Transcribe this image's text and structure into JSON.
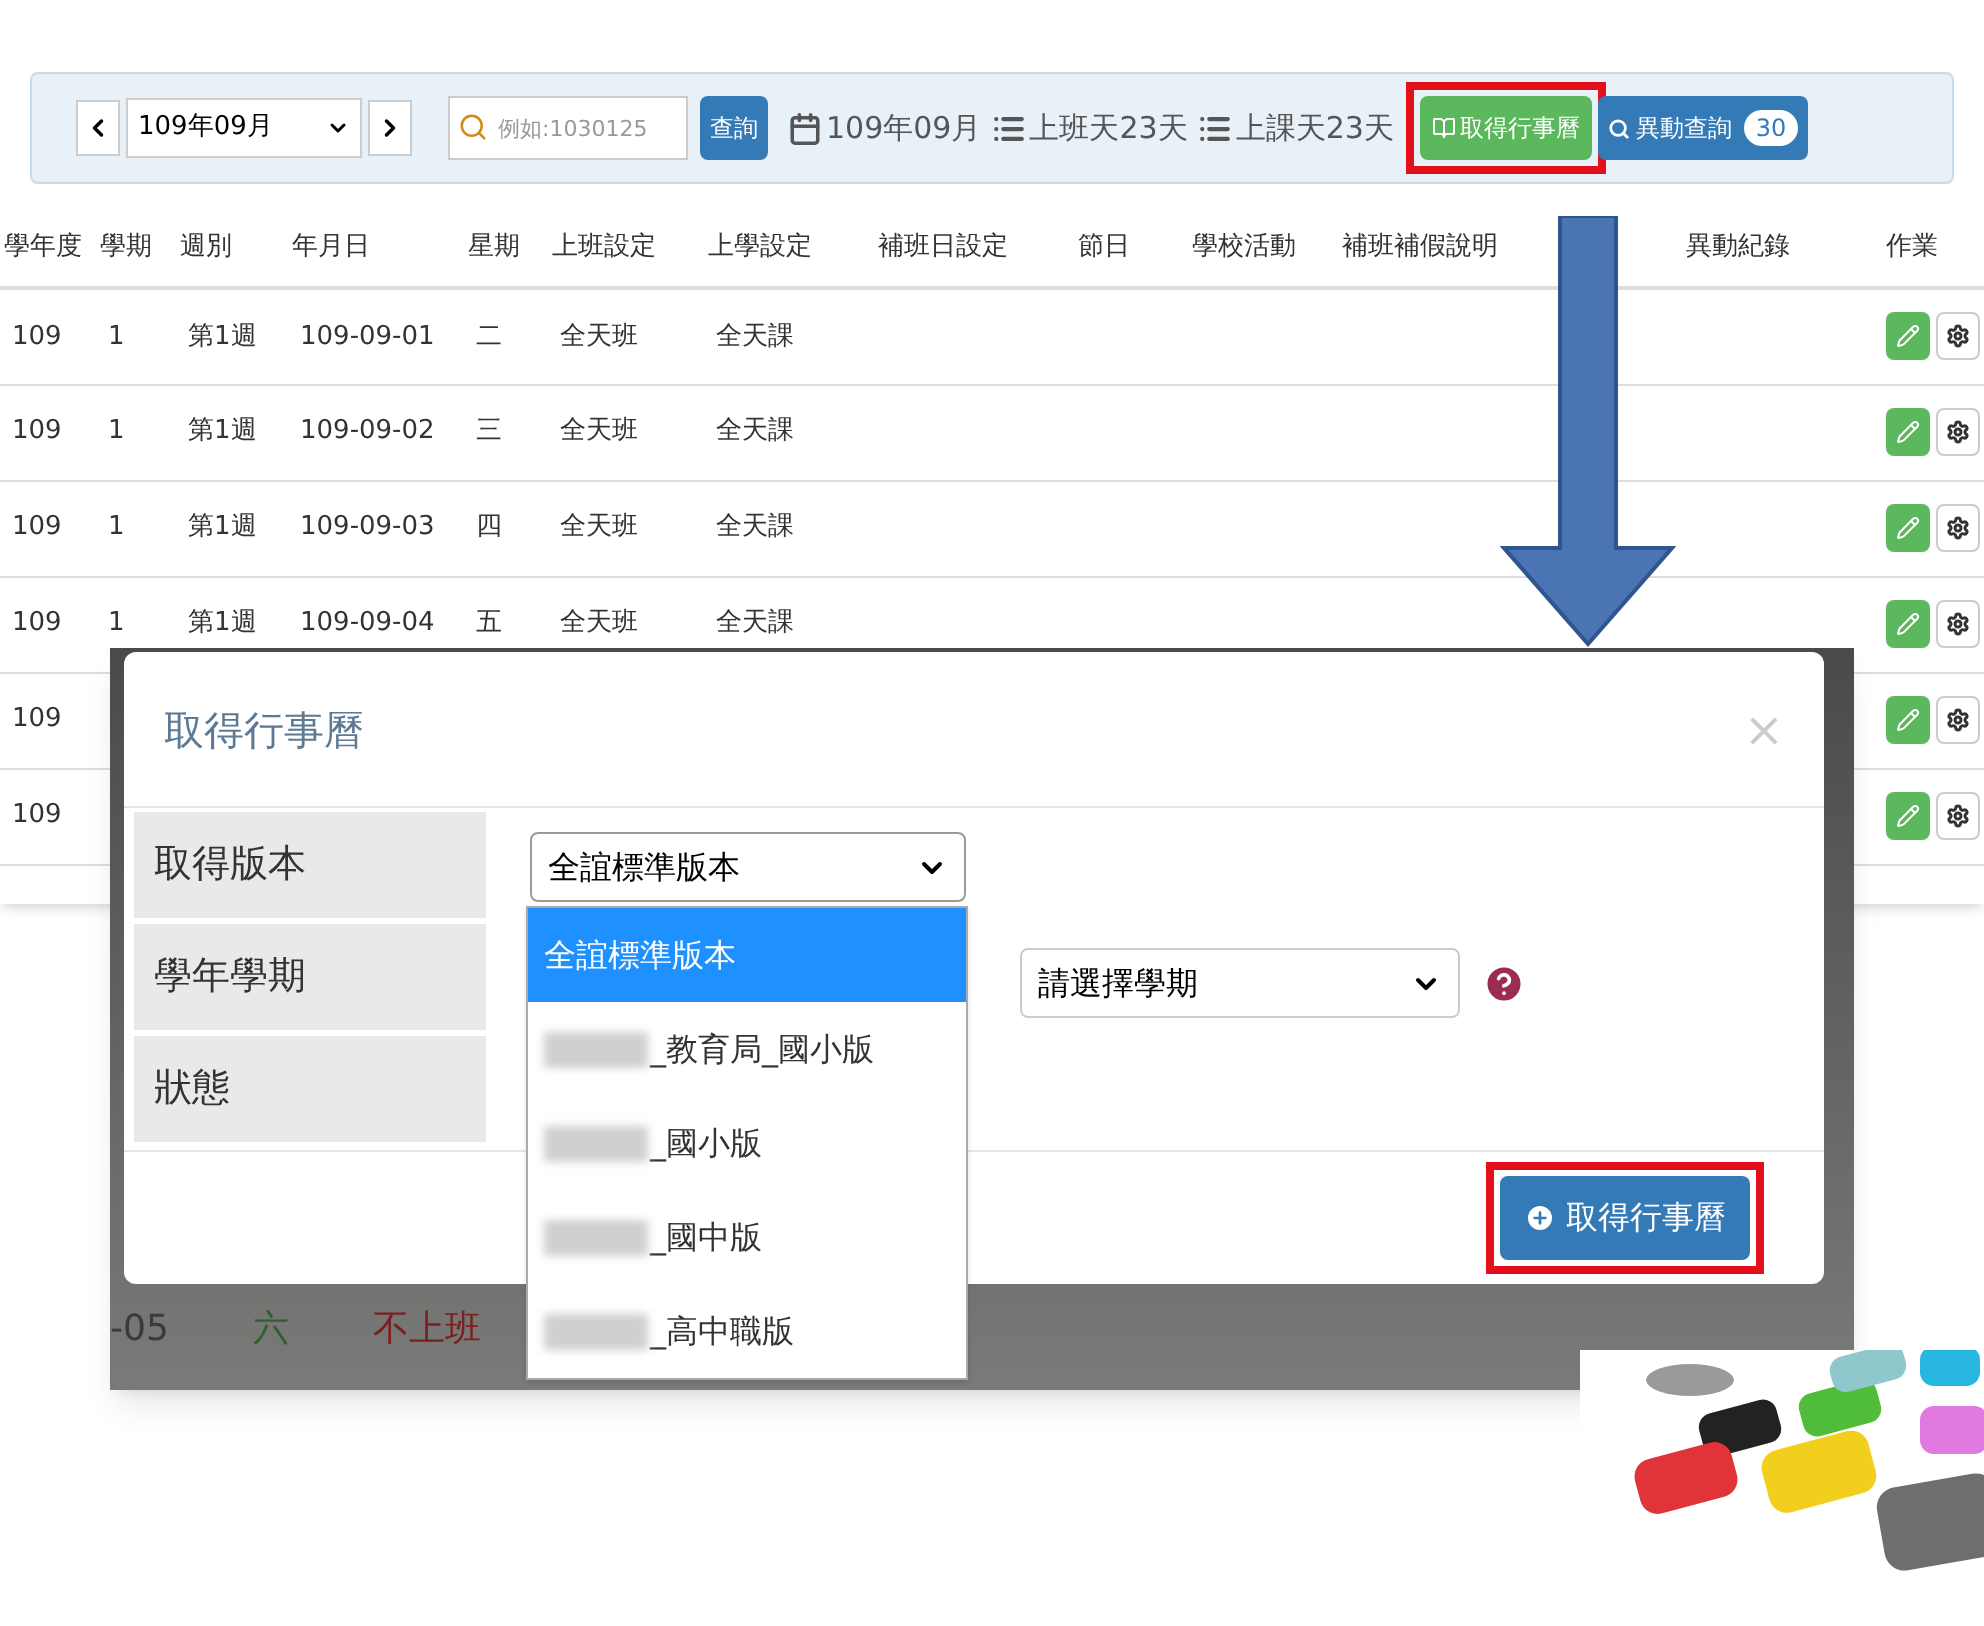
{
  "toolbar": {
    "month_select": {
      "value": "109年09月"
    },
    "search": {
      "placeholder": "例如:1030125"
    },
    "query_button": "查詢",
    "summary": [
      {
        "kind": "calendar",
        "text": "109年09月"
      },
      {
        "kind": "list",
        "text": "上班天23天"
      },
      {
        "kind": "list",
        "text": "上課天23天"
      }
    ],
    "fetch_button": {
      "label": "取得行事曆",
      "highlighted": true
    },
    "changes_button": {
      "label": "異動查詢",
      "badge": "30"
    }
  },
  "table": {
    "columns": [
      "學年度",
      "學期",
      "週別",
      "年月日",
      "星期",
      "上班設定",
      "上學設定",
      "補班日設定",
      "節日",
      "學校活動",
      "補班補假說明",
      "異動紀錄",
      "作業"
    ],
    "rows": [
      {
        "cells": [
          "109",
          "1",
          "第1週",
          "109-09-01",
          "二",
          "全天班",
          "全天課"
        ]
      },
      {
        "cells": [
          "109",
          "1",
          "第1週",
          "109-09-02",
          "三",
          "全天班",
          "全天課"
        ]
      },
      {
        "cells": [
          "109",
          "1",
          "第1週",
          "109-09-03",
          "四",
          "全天班",
          "全天課"
        ]
      },
      {
        "cells": [
          "109",
          "1",
          "第1週",
          "109-09-04",
          "五",
          "全天班",
          "全天課"
        ]
      },
      {
        "cells": [
          "109"
        ]
      },
      {
        "cells": [
          "109"
        ]
      }
    ]
  },
  "backdrop_row": [
    {
      "text": "-05",
      "color": "#3a3a3a"
    },
    {
      "text": "六",
      "color": "#2f5e2f"
    },
    {
      "text": "不上班",
      "color": "#7a2020"
    }
  ],
  "modal": {
    "title": "取得行事曆",
    "close": "×",
    "fields": [
      "取得版本",
      "學年學期",
      "狀態"
    ],
    "version_select": {
      "value": "全誼標準版本",
      "expanded": true,
      "options": [
        {
          "label": "全誼標準版本",
          "selected": true,
          "redacted": false
        },
        {
          "label": "_教育局_國小版",
          "selected": false,
          "redacted": true
        },
        {
          "label": "_國小版",
          "selected": false,
          "redacted": true
        },
        {
          "label": "_國中版",
          "selected": false,
          "redacted": true
        },
        {
          "label": "_高中職版",
          "selected": false,
          "redacted": true
        }
      ]
    },
    "term_select": {
      "value": "請選擇學期"
    },
    "submit_button": {
      "label": "取得行事曆",
      "highlighted": true
    }
  }
}
